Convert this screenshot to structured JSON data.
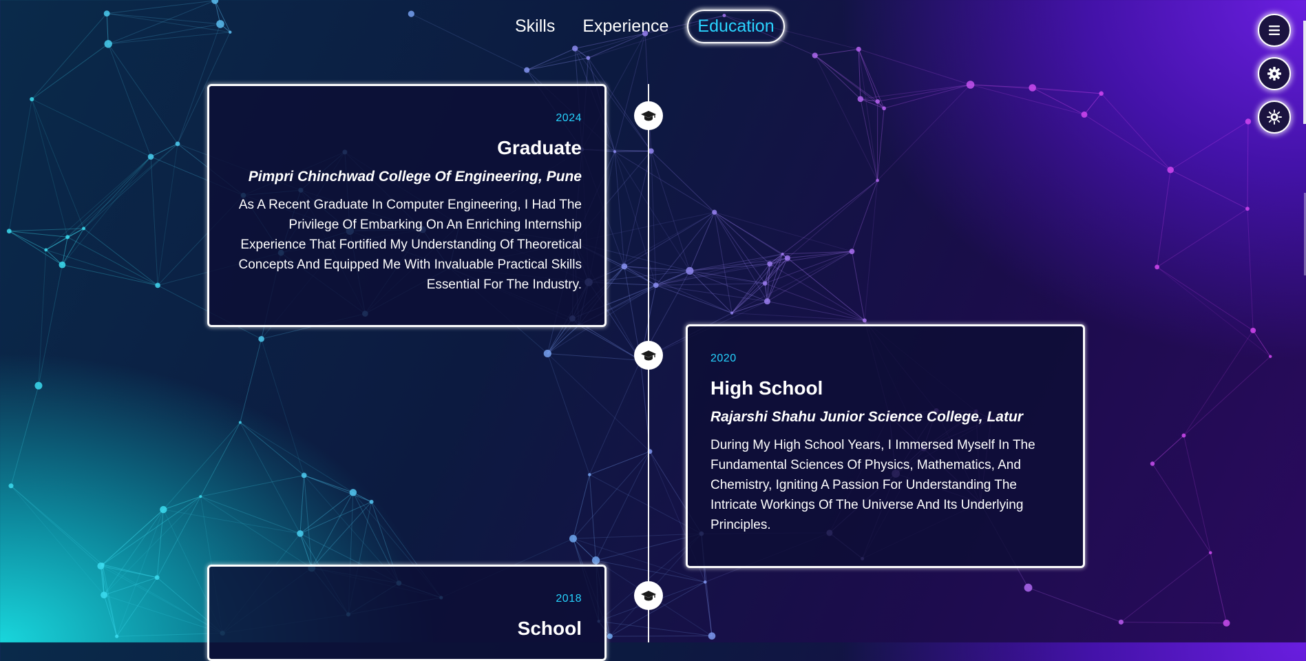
{
  "nav": {
    "items": [
      {
        "label": "Skills",
        "active": false
      },
      {
        "label": "Experience",
        "active": false
      },
      {
        "label": "Education",
        "active": true
      }
    ],
    "accent_color": "#26d3ff"
  },
  "side_buttons": [
    {
      "icon": "menu-icon"
    },
    {
      "icon": "settings-gear-icon"
    },
    {
      "icon": "theme-toggle-icon"
    }
  ],
  "education": [
    {
      "year": "2024",
      "degree": "Graduate",
      "institution": "Pimpri Chinchwad College Of Engineering, Pune",
      "description": "As A Recent Graduate In Computer Engineering, I Had The Privilege Of Embarking On An Enriching Internship Experience That Fortified My Understanding Of Theoretical Concepts And Equipped Me With Invaluable Practical Skills Essential For The Industry.",
      "icon": "graduation-cap-icon"
    },
    {
      "year": "2020",
      "degree": "High School",
      "institution": "Rajarshi Shahu Junior Science College, Latur",
      "description": "During My High School Years, I Immersed Myself In The Fundamental Sciences Of Physics, Mathematics, And Chemistry, Igniting A Passion For Understanding The Intricate Workings Of The Universe And Its Underlying Principles.",
      "icon": "graduation-cap-icon"
    },
    {
      "year": "2018",
      "degree": "School",
      "icon": "graduation-cap-icon"
    }
  ]
}
